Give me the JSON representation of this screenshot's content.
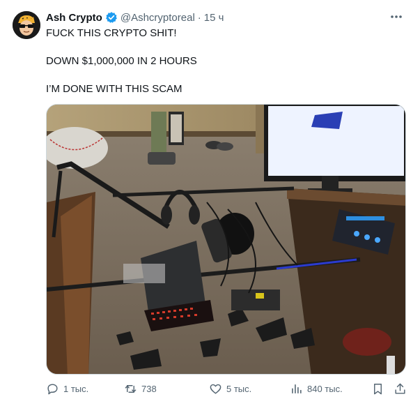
{
  "author": {
    "name": "Ash Crypto",
    "handle": "@Ashcryptoreal",
    "separator": "·",
    "time": "15 ч",
    "verified": true,
    "badge_color": "#1d9bf0"
  },
  "tweet": {
    "lines": [
      "FUCK THIS CRYPTO SHIT!",
      "DOWN $1,000,000 IN 2 HOURS",
      "I’M DONE WITH THIS SCAM"
    ]
  },
  "media": {
    "image_icon": "photo-of-smashed-desk-setup"
  },
  "actions": {
    "reply": {
      "icon": "reply-icon",
      "count": "1 тыс."
    },
    "retweet": {
      "icon": "retweet-icon",
      "count": "738"
    },
    "like": {
      "icon": "heart-icon",
      "count": "5 тыс."
    },
    "views": {
      "icon": "views-icon",
      "count": "840 тыс."
    },
    "bookmark": {
      "icon": "bookmark-icon"
    },
    "share": {
      "icon": "share-icon"
    }
  },
  "colors": {
    "text": "#0f1419",
    "muted": "#536471",
    "accent": "#1d9bf0"
  }
}
